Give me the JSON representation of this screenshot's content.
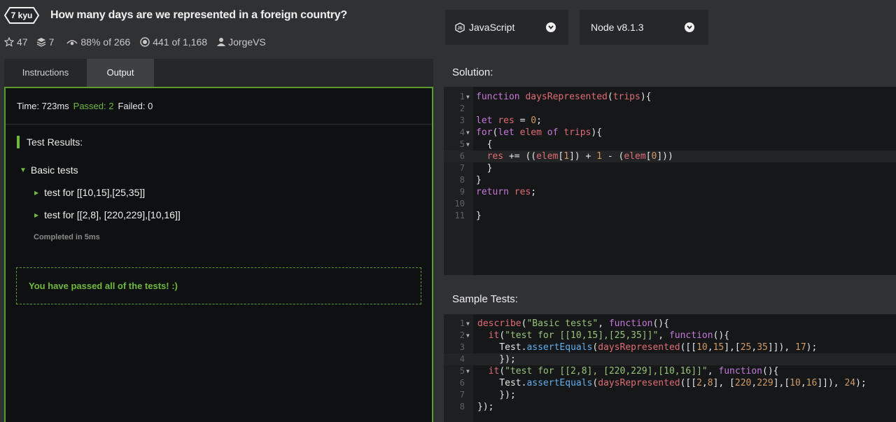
{
  "kata": {
    "rank": "7 kyu",
    "title": "How many days are we represented in a foreign country?",
    "stars": "47",
    "collections": "7",
    "satisfaction": "88% of 266",
    "completed": "441 of 1,168",
    "author": "JorgeVS"
  },
  "selectors": {
    "language": "JavaScript",
    "version": "Node v8.1.3"
  },
  "tabs": {
    "instructions": "Instructions",
    "output": "Output"
  },
  "output": {
    "time": "Time: 723ms",
    "passed": "Passed: 2",
    "failed": "Failed: 0",
    "results_title": "Test Results:",
    "group": "Basic tests",
    "tests": [
      "test for [[10,15],[25,35]]",
      "test for [[2,8], [220,229],[10,16]]"
    ],
    "completed": "Completed in 5ms",
    "success": "You have passed all of the tests! :)"
  },
  "solution": {
    "title": "Solution:",
    "line_numbers": [
      "1",
      "2",
      "3",
      "4",
      "5",
      "6",
      "7",
      "8",
      "9",
      "10",
      "11"
    ]
  },
  "sample_tests": {
    "title": "Sample Tests:",
    "line_numbers": [
      "1",
      "2",
      "3",
      "4",
      "5",
      "6",
      "7",
      "8"
    ]
  }
}
